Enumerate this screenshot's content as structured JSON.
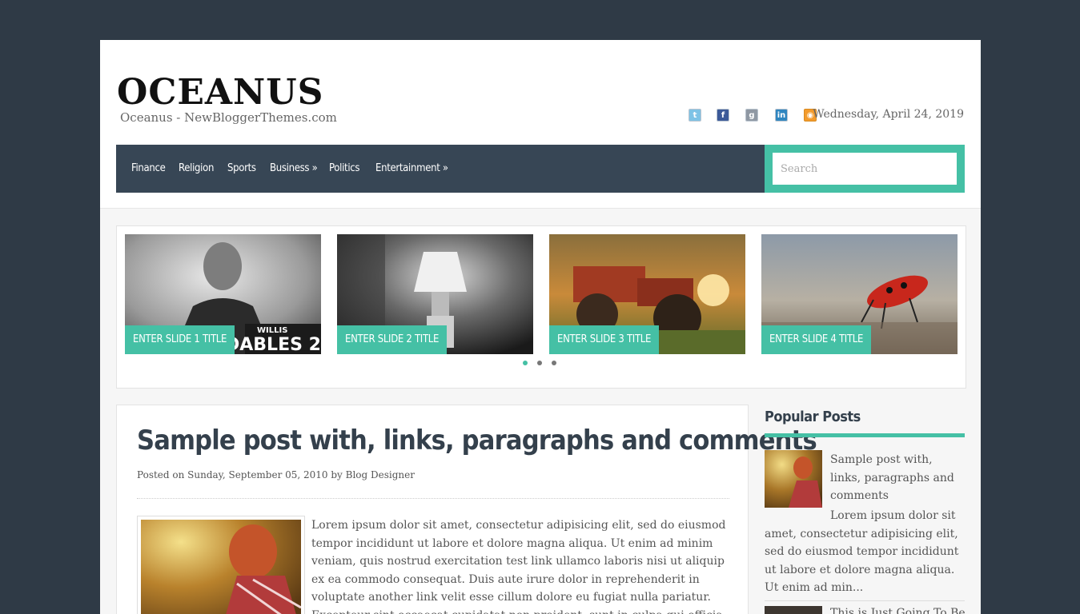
{
  "header": {
    "site_title": "OCEANUS",
    "site_description": "Oceanus - NewBloggerThemes.com",
    "date": "Wednesday, April 24, 2019",
    "social_icons": [
      "twitter-icon",
      "facebook-icon",
      "google-plus-icon",
      "linkedin-icon",
      "rss-icon"
    ]
  },
  "nav": {
    "items": [
      {
        "label": "Finance"
      },
      {
        "label": "Religion"
      },
      {
        "label": "Sports"
      },
      {
        "label": "Business »"
      },
      {
        "label": "Politics"
      },
      {
        "label": "Entertainment »"
      }
    ]
  },
  "search": {
    "placeholder": "Search"
  },
  "slider": {
    "slides": [
      {
        "title": "ENTER SLIDE 1 TITLE",
        "overlay_text": "WILLIS",
        "overlay_text2": "DABLES 2"
      },
      {
        "title": "ENTER SLIDE 2 TITLE"
      },
      {
        "title": "ENTER SLIDE 3 TITLE"
      },
      {
        "title": "ENTER SLIDE 4 TITLE"
      }
    ],
    "active_dot": 1,
    "dot_count": 3
  },
  "post": {
    "title": "Sample post with, links, paragraphs and comments",
    "meta": "Posted on Sunday, September 05, 2010 by Blog Designer",
    "excerpt": "Lorem ipsum dolor sit amet, consectetur adipisicing elit, sed do eiusmod tempor incididunt ut labore et dolore magna aliqua. Ut enim ad minim veniam, quis nostrud exercitation test link ullamco laboris nisi ut aliquip ex ea commodo consequat. Duis aute irure dolor in reprehenderit in voluptate another link velit esse cillum dolore eu fugiat nulla pariatur. Excepteur sint occaecat cupidatat non proident, sunt in culpa qui officia deserunt mollit"
  },
  "sidebar": {
    "widget_title": "Popular Posts",
    "posts": [
      {
        "title": "Sample post with, links, paragraphs and comments",
        "excerpt": "Lorem ipsum dolor sit amet, consectetur adipisicing elit, sed do eiusmod tempor incididunt ut labore et dolore magna aliqua. Ut enim ad min..."
      },
      {
        "title": "This is Just Going To Be"
      }
    ]
  },
  "colors": {
    "accent": "#45c0a5",
    "nav_bg": "#374655",
    "page_bg": "#2f3a46"
  }
}
